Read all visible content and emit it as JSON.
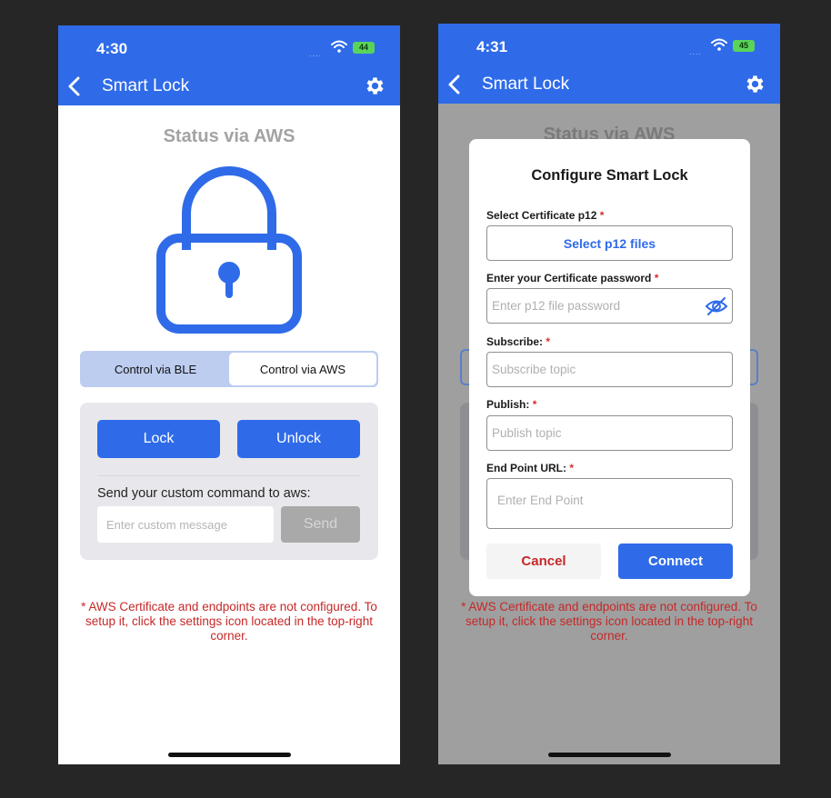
{
  "colors": {
    "primary": "#2f6be9",
    "warning": "#c62828",
    "background": "#262626"
  },
  "screen1": {
    "time": "4:30",
    "signal": "....",
    "battery": "44",
    "title": "Smart Lock",
    "status_title": "Status via AWS",
    "segment": {
      "ble": "Control via BLE",
      "aws": "Control via AWS",
      "selected": "aws"
    },
    "lock_button": "Lock",
    "unlock_button": "Unlock",
    "custom_label": "Send your custom command to aws:",
    "custom_placeholder": "Enter custom message",
    "send_button": "Send",
    "warning": "* AWS Certificate and endpoints are not configured. To setup it, click the settings icon located in the top-right corner."
  },
  "screen2": {
    "time": "4:31",
    "signal": "....",
    "battery": "45",
    "title": "Smart Lock",
    "status_title": "Status via AWS",
    "warning": "* AWS Certificate and endpoints are not configured. To setup it, click the settings icon located in the top-right corner.",
    "modal": {
      "title": "Configure Smart Lock",
      "cert_label": "Select Certificate p12",
      "cert_button": "Select p12 files",
      "password_label": "Enter your Certificate password",
      "password_placeholder": "Enter p12 file password",
      "subscribe_label": "Subscribe:",
      "subscribe_placeholder": "Subscribe topic",
      "publish_label": "Publish:",
      "publish_placeholder": "Publish topic",
      "endpoint_label": "End Point URL:",
      "endpoint_placeholder": "Enter End Point",
      "required_mark": "*",
      "cancel_button": "Cancel",
      "connect_button": "Connect"
    }
  },
  "icons": {
    "back": "chevron-left-icon",
    "settings": "gear-icon",
    "wifi": "wifi-icon",
    "lock": "padlock-icon",
    "visibility": "eye-off-icon"
  }
}
